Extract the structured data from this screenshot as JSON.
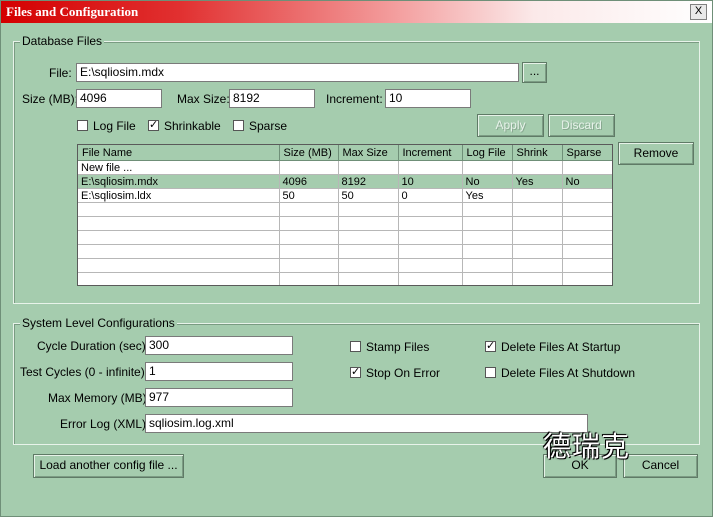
{
  "window": {
    "title": "Files and Configuration",
    "close_glyph": "X"
  },
  "database_files": {
    "group_label": "Database Files",
    "file_label": "File:",
    "file_value": "E:\\sqliosim.mdx",
    "browse_label": "...",
    "size_label": "Size (MB):",
    "size_value": "4096",
    "max_size_label": "Max Size:",
    "max_size_value": "8192",
    "increment_label": "Increment:",
    "increment_value": "10",
    "log_file_label": "Log File",
    "log_file_checked": false,
    "shrinkable_label": "Shrinkable",
    "shrinkable_checked": true,
    "sparse_label": "Sparse",
    "sparse_checked": false,
    "apply_label": "Apply",
    "discard_label": "Discard",
    "remove_label": "Remove",
    "table": {
      "columns": [
        "File Name",
        "Size (MB)",
        "Max Size",
        "Increment",
        "Log File",
        "Shrink",
        "Sparse"
      ],
      "rows": [
        [
          "New file ...",
          "",
          "",
          "",
          "",
          "",
          ""
        ],
        [
          "E:\\sqliosim.mdx",
          "4096",
          "8192",
          "10",
          "No",
          "Yes",
          "No"
        ],
        [
          "E:\\sqliosim.ldx",
          "50",
          "50",
          "0",
          "Yes",
          "",
          ""
        ],
        [
          "",
          "",
          "",
          "",
          "",
          "",
          ""
        ],
        [
          "",
          "",
          "",
          "",
          "",
          "",
          ""
        ],
        [
          "",
          "",
          "",
          "",
          "",
          "",
          ""
        ],
        [
          "",
          "",
          "",
          "",
          "",
          "",
          ""
        ],
        [
          "",
          "",
          "",
          "",
          "",
          "",
          ""
        ],
        [
          "",
          "",
          "",
          "",
          "",
          "",
          ""
        ]
      ],
      "selected_row": 1
    }
  },
  "system_config": {
    "group_label": "System Level Configurations",
    "cycle_duration_label": "Cycle Duration (sec):",
    "cycle_duration_value": "300",
    "test_cycles_label": "Test Cycles (0 - infinite):",
    "test_cycles_value": "1",
    "max_memory_label": "Max Memory (MB):",
    "max_memory_value": "977",
    "error_log_label": "Error Log (XML):",
    "error_log_value": "sqliosim.log.xml",
    "stamp_files_label": "Stamp Files",
    "stamp_files_checked": false,
    "stop_on_error_label": "Stop On Error",
    "stop_on_error_checked": true,
    "delete_startup_label": "Delete Files At Startup",
    "delete_startup_checked": true,
    "delete_shutdown_label": "Delete Files At Shutdown",
    "delete_shutdown_checked": false
  },
  "footer": {
    "load_config_label": "Load another config file ...",
    "ok_label": "OK",
    "cancel_label": "Cancel"
  },
  "watermark": "德瑞克",
  "check_glyph": "✓"
}
